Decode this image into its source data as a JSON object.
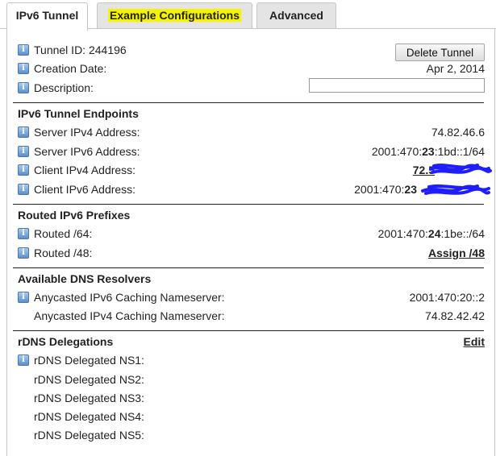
{
  "tabs": [
    {
      "label": "IPv6 Tunnel",
      "active": true
    },
    {
      "label": "Example Configurations",
      "highlighted": true
    },
    {
      "label": "Advanced"
    }
  ],
  "general": {
    "tunnel_id_label": "Tunnel ID: 244196",
    "delete_button": "Delete Tunnel",
    "creation_date_label": "Creation Date:",
    "creation_date_value": "Apr 2, 2014",
    "description_label": "Description:",
    "description_value": ""
  },
  "endpoints": {
    "heading": "IPv6 Tunnel Endpoints",
    "server_ipv4_label": "Server IPv4 Address:",
    "server_ipv4_value": "74.82.46.6",
    "server_ipv6_label": "Server IPv6 Address:",
    "server_ipv6_prefix": "2001:470:",
    "server_ipv6_bold": "23",
    "server_ipv6_suffix": ":1bd::1/64",
    "client_ipv4_label": "Client IPv4 Address:",
    "client_ipv4_visible": "72.5",
    "client_ipv6_label": "Client IPv6 Address:",
    "client_ipv6_prefix": "2001:470:",
    "client_ipv6_bold": "23"
  },
  "prefixes": {
    "heading": "Routed IPv6 Prefixes",
    "routed64_label": "Routed /64:",
    "routed64_prefix": "2001:470:",
    "routed64_bold": "24",
    "routed64_suffix": ":1be::/64",
    "routed48_label": "Routed /48:",
    "routed48_link": "Assign /48"
  },
  "dns": {
    "heading": "Available DNS Resolvers",
    "ipv6_label": "Anycasted IPv6 Caching Nameserver:",
    "ipv6_value": "2001:470:20::2",
    "ipv4_label": "Anycasted IPv4 Caching Nameserver:",
    "ipv4_value": "74.82.42.42"
  },
  "rdns": {
    "heading": "rDNS Delegations",
    "edit_link": "Edit",
    "ns": [
      "rDNS Delegated NS1:",
      "rDNS Delegated NS2:",
      "rDNS Delegated NS3:",
      "rDNS Delegated NS4:",
      "rDNS Delegated NS5:"
    ]
  },
  "icons": {
    "info": "i"
  },
  "colors": {
    "highlight": "#f5f300",
    "redaction": "#1e1eff",
    "info_icon": "#5c8fcf"
  }
}
